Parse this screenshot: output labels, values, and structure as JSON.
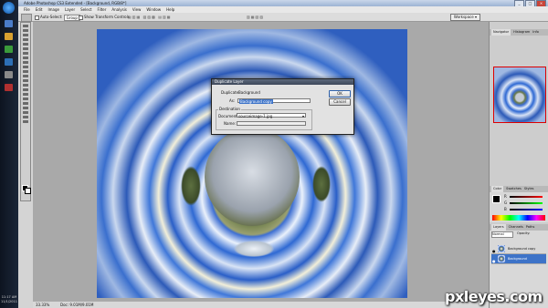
{
  "window": {
    "title": "Adobe Photoshop CS3 Extended - [Background, RGB/8*]",
    "controls": [
      "_",
      "□",
      "×"
    ]
  },
  "taskbar": {
    "clock_time": "11:17 AM",
    "clock_date": "11/1/2011"
  },
  "menubar": {
    "items": [
      "File",
      "Edit",
      "Image",
      "Layer",
      "Select",
      "Filter",
      "Analysis",
      "View",
      "Window",
      "Help"
    ]
  },
  "options": {
    "auto_select_label": "Auto-Select:",
    "auto_select_value": "Group",
    "show_transform_label": "Show Transform Controls",
    "workspace_label": "Workspace ▾"
  },
  "canvas": {
    "zoom": "33.33%",
    "doc_info": "Doc: 9.01M/9.01M"
  },
  "dialog": {
    "title": "Duplicate Layer",
    "duplicate_label": "Duplicate:",
    "duplicate_value": "Background",
    "as_label": "As:",
    "as_value": "Background copy",
    "destination_label": "Destination",
    "document_label": "Document:",
    "document_value": "sourceimage-1.jpg",
    "name_label": "Name:",
    "ok_label": "OK",
    "cancel_label": "Cancel"
  },
  "panels": {
    "nav_tabs": [
      "Navigator",
      "Histogram",
      "Info"
    ],
    "color_tabs": [
      "Color",
      "Swatches",
      "Styles"
    ],
    "color_labels": [
      "R",
      "G",
      "B"
    ],
    "layers_tabs": [
      "Layers",
      "Channels",
      "Paths"
    ],
    "blend_mode": "Normal",
    "opacity_label": "Opacity:",
    "layers": [
      {
        "name": "Background copy",
        "selected": false
      },
      {
        "name": "Background",
        "selected": true
      }
    ]
  },
  "watermark": "pxleyes.com",
  "colors": {
    "selection_blue": "#3d73c8",
    "panel_gray": "#cdcdcd",
    "canvas_bg": "#a9a9a9"
  }
}
